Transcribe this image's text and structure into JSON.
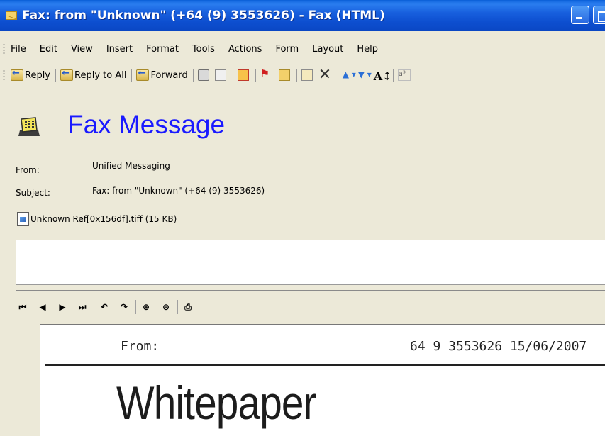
{
  "window": {
    "title": "Fax: from \"Unknown\" (+64 (9) 3553626) - Fax (HTML)"
  },
  "menu": {
    "items": [
      {
        "label": "File"
      },
      {
        "label": "Edit"
      },
      {
        "label": "View"
      },
      {
        "label": "Insert"
      },
      {
        "label": "Format"
      },
      {
        "label": "Tools"
      },
      {
        "label": "Actions"
      },
      {
        "label": "Form"
      },
      {
        "label": "Layout"
      },
      {
        "label": "Help"
      }
    ]
  },
  "toolbar": {
    "reply_label": "Reply",
    "reply_all_label": "Reply to All",
    "forward_label": "Forward",
    "icons": [
      "reply-icon",
      "reply-all-icon",
      "forward-icon",
      "print-icon",
      "copy-icon",
      "envelope-icon",
      "flag-icon",
      "open-folder-icon",
      "move-icon",
      "delete-icon",
      "previous-item-icon",
      "next-item-icon",
      "font-size-icon",
      "encoding-icon"
    ]
  },
  "message": {
    "header_title": "Fax Message",
    "from_label": "From:",
    "from_value": "Unified Messaging",
    "subject_label": "Subject:",
    "subject_value": "Fax: from \"Unknown\" (+64 (9) 3553626)",
    "attachment": "Unknown Ref[0x156df].tiff (15 KB)"
  },
  "viewer": {
    "icons": [
      "first-page-icon",
      "prev-page-icon",
      "next-page-icon",
      "last-page-icon",
      "rotate-left-icon",
      "rotate-right-icon",
      "zoom-in-icon",
      "zoom-out-icon",
      "print-icon"
    ],
    "fax_from": "From:",
    "fax_number_date": "64 9 3553626   15/06/2007",
    "fax_heading": "Whitepaper"
  }
}
